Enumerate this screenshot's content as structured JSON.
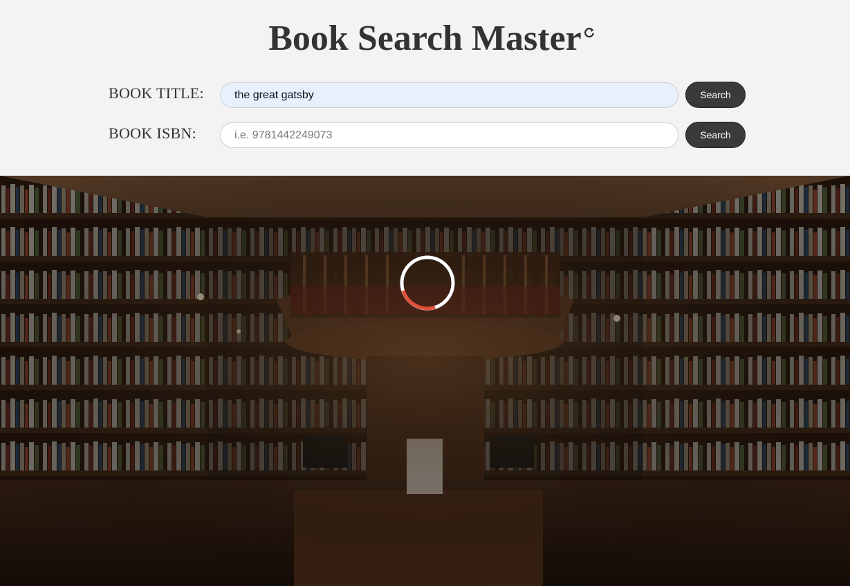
{
  "app": {
    "title": "Book Search Master"
  },
  "search": {
    "title_label": "BOOK TITLE:",
    "title_value": "the great gatsby",
    "title_placeholder": "",
    "isbn_label": "BOOK ISBN:",
    "isbn_value": "",
    "isbn_placeholder": "i.e. 9781442249073",
    "title_button": "Search",
    "isbn_button": "Search"
  },
  "hero": {
    "image": "bookstore-library-interior",
    "loading": true,
    "spinner_colors": {
      "base": "#ffffff",
      "accent": "#e0503a"
    }
  },
  "icons": {
    "title_icon": "refresh-icon"
  }
}
